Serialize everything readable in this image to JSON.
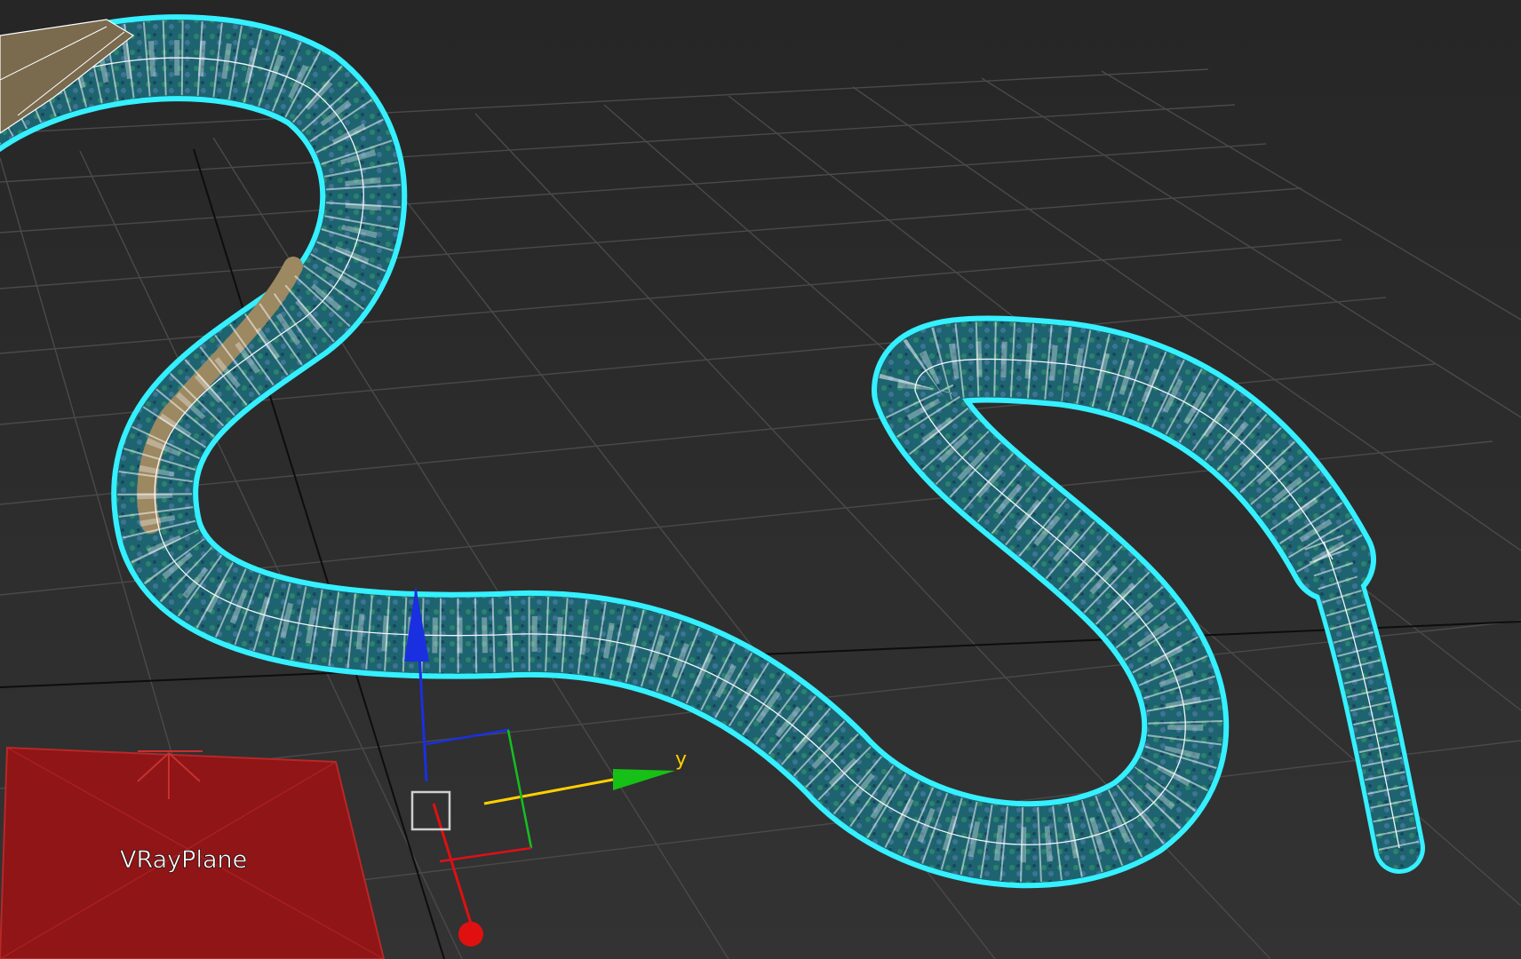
{
  "viewport": {
    "background_color": "#2e2e2e",
    "grid_color": "#4a4a4a",
    "axis_line_color": "#0d0d0d"
  },
  "objects": {
    "plane": {
      "label": "VRayPlane",
      "color": "#8f1516",
      "edge_color": "#b92727"
    },
    "snake": {
      "selection_outline_color": "#35f0ff",
      "wire_color": "#ffffff",
      "body_color": "#1d6470",
      "belly_color": "#9c8861"
    }
  },
  "gizmo": {
    "y_axis_label": "y",
    "x_color": "#e01010",
    "y_color": "#16c016",
    "z_color": "#1a2fe0",
    "highlight_color": "#ffd000"
  }
}
